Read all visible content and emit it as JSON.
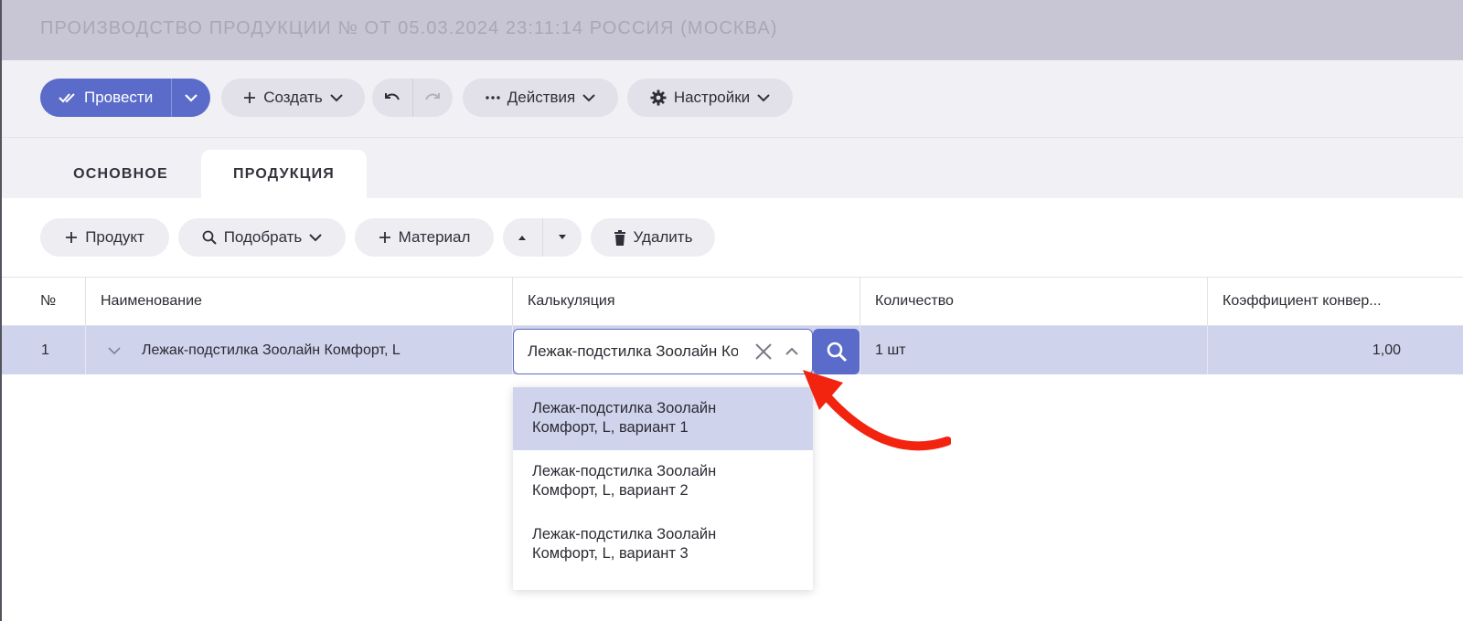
{
  "window": {
    "title": "ПРОИЗВОДСТВО ПРОДУКЦИИ № ОТ 05.03.2024 23:11:14 РОССИЯ (МОСКВА)"
  },
  "toolbar": {
    "post_label": "Провести",
    "create_label": "Создать",
    "actions_label": "Действия",
    "settings_label": "Настройки"
  },
  "tabs": [
    {
      "label": "ОСНОВНОЕ",
      "active": false
    },
    {
      "label": "ПРОДУКЦИЯ",
      "active": true
    }
  ],
  "subtoolbar": {
    "product_label": "Продукт",
    "pick_label": "Подобрать",
    "material_label": "Материал",
    "delete_label": "Удалить"
  },
  "table": {
    "columns": [
      "№",
      "Наименование",
      "Калькуляция",
      "Количество",
      "Коэффициент конвер..."
    ],
    "rows": [
      {
        "num": "1",
        "name": "Лежак-подстилка Зоолайн Комфорт, L",
        "calc": "Лежак-подстилка Зоолайн Комфорт, L, вариант 1",
        "qty": "1 шт",
        "coef": "1,00"
      }
    ]
  },
  "calc_dropdown": {
    "options": [
      {
        "line1": "Лежак-подстилка Зоолайн",
        "line2": "Комфорт, L, вариант 1",
        "selected": true
      },
      {
        "line1": "Лежак-подстилка Зоолайн",
        "line2": "Комфорт, L, вариант 2",
        "selected": false
      },
      {
        "line1": "Лежак-подстилка Зоолайн",
        "line2": "Комфорт, L, вариант 3",
        "selected": false
      }
    ]
  },
  "colors": {
    "accent": "#5b6bc9",
    "row_highlight": "#d0d3ec",
    "annotation_arrow": "#f2230f"
  }
}
